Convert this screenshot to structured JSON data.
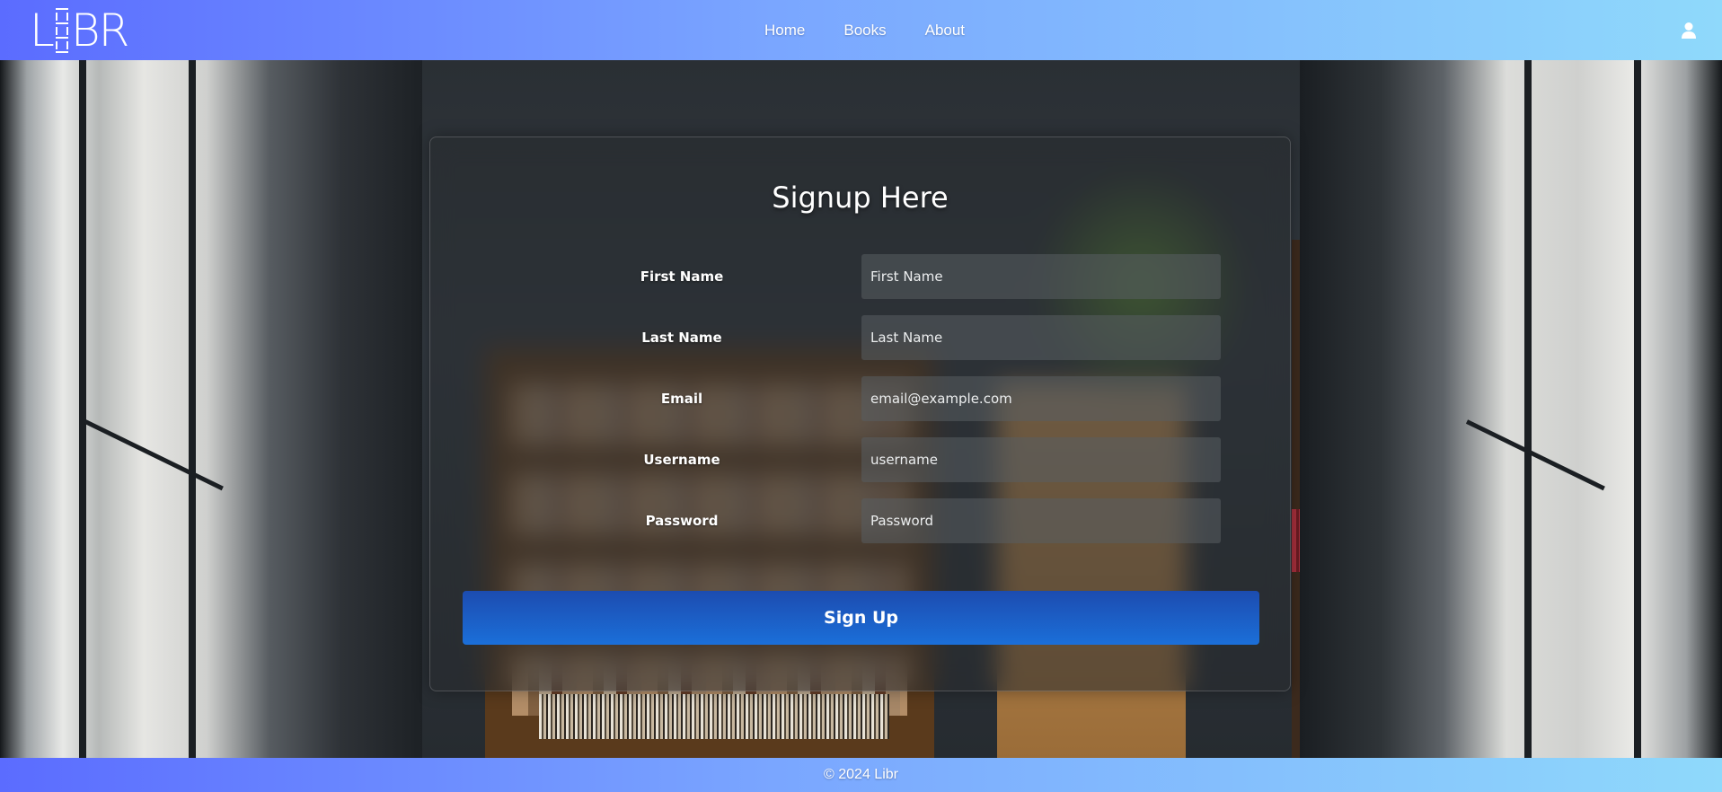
{
  "brand": {
    "logo_text": "LIBR"
  },
  "nav": {
    "items": [
      {
        "label": "Home"
      },
      {
        "label": "Books"
      },
      {
        "label": "About"
      }
    ],
    "user_icon": "user-icon"
  },
  "form": {
    "title": "Signup Here",
    "fields": [
      {
        "label": "First Name",
        "placeholder": "First Name",
        "value": ""
      },
      {
        "label": "Last Name",
        "placeholder": "Last Name",
        "value": ""
      },
      {
        "label": "Email",
        "placeholder": "email@example.com",
        "value": ""
      },
      {
        "label": "Username",
        "placeholder": "username",
        "value": ""
      },
      {
        "label": "Password",
        "placeholder": "Password",
        "value": ""
      }
    ],
    "submit_label": "Sign Up"
  },
  "footer": {
    "text": "© 2024 Libr"
  },
  "colors": {
    "header_gradient_start": "#5b6cff",
    "header_gradient_end": "#8fd9fb",
    "button_start": "#1c4cb0",
    "button_end": "#1b6fd9"
  }
}
